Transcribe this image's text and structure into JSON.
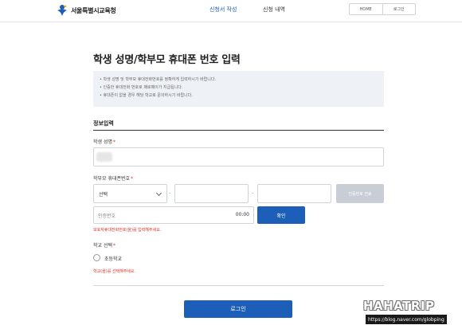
{
  "header": {
    "logo_text": "서울특별시교육청",
    "nav": [
      "신청서 작성",
      "신청 내역"
    ],
    "buttons": [
      "HOME",
      "로그인"
    ]
  },
  "page": {
    "title": "학생 성명/학부모 휴대폰 번호 입력",
    "notices": [
      "학생 성명 및 학부모 휴대전화번호를 정확하게 입력하시기 바랍니다.",
      "인증한 휴대전화 번호로 패로페이가 지급됩니다.",
      "휴대폰이 없을 경우 해당 학교로 문의하시기 바랍니다."
    ]
  },
  "form": {
    "section_title": "정보입력",
    "name_label": "학생 성명",
    "phone_label": "학부모 휴대폰번호",
    "phone_select_value": "선택",
    "dash": "-",
    "auth_send_label": "인증번호 전송",
    "auth_placeholder": "인증번호",
    "auth_timer": "00:00",
    "confirm_label": "확인",
    "auth_error": "보호자휴대전화번호(을)를 입력해주세요.",
    "school_label": "학교 선택",
    "school_option": "초등학교",
    "school_error": "학교(을)를 선택해주세요.",
    "required_mark": "*",
    "login_label": "로그인"
  },
  "watermark": {
    "title": "HAHATRIP",
    "url": "https://blog.naver.com/globping"
  },
  "colors": {
    "primary": "#1d5fb8",
    "error": "#d93025",
    "notice_bg": "#eef2f7",
    "disabled": "#c9ced6"
  }
}
